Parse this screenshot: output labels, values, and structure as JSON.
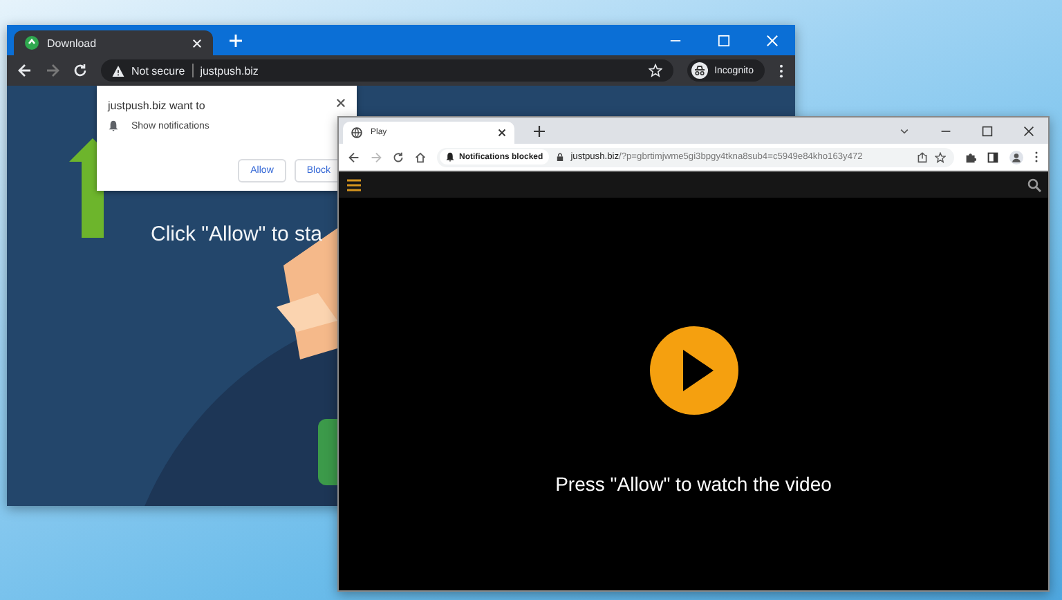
{
  "back_window": {
    "tab": {
      "title": "Download"
    },
    "address": {
      "security": "Not secure",
      "url": "justpush.biz"
    },
    "profile": "Incognito",
    "heading": "Click \"Allow\" to sta"
  },
  "permission_popup": {
    "title": "justpush.biz want to",
    "permission": "Show notifications",
    "buttons": [
      "Allow",
      "Block"
    ]
  },
  "front_window": {
    "tab": {
      "title": "Play"
    },
    "notice": "Notifications blocked",
    "url": {
      "domain": "justpush.biz",
      "path": "/?p=gbrtimjwme5gi3bpgy4tkna8sub4=c5949e84kho163y472"
    },
    "message": "Press \"Allow\" to watch the video"
  }
}
